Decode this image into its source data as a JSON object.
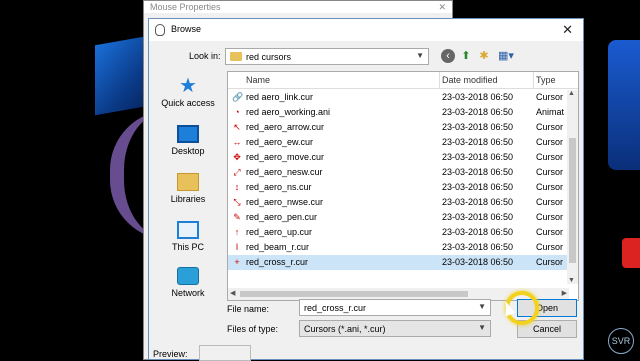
{
  "back_window": {
    "title": "Mouse Properties",
    "close": "✕"
  },
  "dialog": {
    "title": "Browse",
    "close": "✕",
    "look_in_label": "Look in:",
    "look_in_value": "red cursors",
    "places": [
      {
        "label": "Quick access",
        "icon": "star-icon"
      },
      {
        "label": "Desktop",
        "icon": "desktop-icon"
      },
      {
        "label": "Libraries",
        "icon": "libraries-icon"
      },
      {
        "label": "This PC",
        "icon": "computer-icon"
      },
      {
        "label": "Network",
        "icon": "network-icon"
      }
    ],
    "columns": {
      "name": "Name",
      "date": "Date modified",
      "type": "Type"
    },
    "files": [
      {
        "name": "red aero_link.cur",
        "date": "23-03-2018 06:50",
        "type": "Cursor",
        "glyph": "🔗"
      },
      {
        "name": "red aero_working.ani",
        "date": "23-03-2018 06:50",
        "type": "Animat",
        "glyph": "◔"
      },
      {
        "name": "red_aero_arrow.cur",
        "date": "23-03-2018 06:50",
        "type": "Cursor",
        "glyph": "↖"
      },
      {
        "name": "red_aero_ew.cur",
        "date": "23-03-2018 06:50",
        "type": "Cursor",
        "glyph": "↔"
      },
      {
        "name": "red_aero_move.cur",
        "date": "23-03-2018 06:50",
        "type": "Cursor",
        "glyph": "✥"
      },
      {
        "name": "red_aero_nesw.cur",
        "date": "23-03-2018 06:50",
        "type": "Cursor",
        "glyph": "⤢"
      },
      {
        "name": "red_aero_ns.cur",
        "date": "23-03-2018 06:50",
        "type": "Cursor",
        "glyph": "↕"
      },
      {
        "name": "red_aero_nwse.cur",
        "date": "23-03-2018 06:50",
        "type": "Cursor",
        "glyph": "⤡"
      },
      {
        "name": "red_aero_pen.cur",
        "date": "23-03-2018 06:50",
        "type": "Cursor",
        "glyph": "✎"
      },
      {
        "name": "red_aero_up.cur",
        "date": "23-03-2018 06:50",
        "type": "Cursor",
        "glyph": "↑"
      },
      {
        "name": "red_beam_r.cur",
        "date": "23-03-2018 06:50",
        "type": "Cursor",
        "glyph": "I"
      },
      {
        "name": "red_cross_r.cur",
        "date": "23-03-2018 06:50",
        "type": "Cursor",
        "glyph": "+"
      }
    ],
    "selected_index": 11,
    "file_name_label": "File name:",
    "file_name_value": "red_cross_r.cur",
    "file_type_label": "Files of type:",
    "file_type_value": "Cursors (*.ani, *.cur)",
    "open_label": "Open",
    "cancel_label": "Cancel",
    "preview_label": "Preview:"
  },
  "logo_text": "SVR"
}
